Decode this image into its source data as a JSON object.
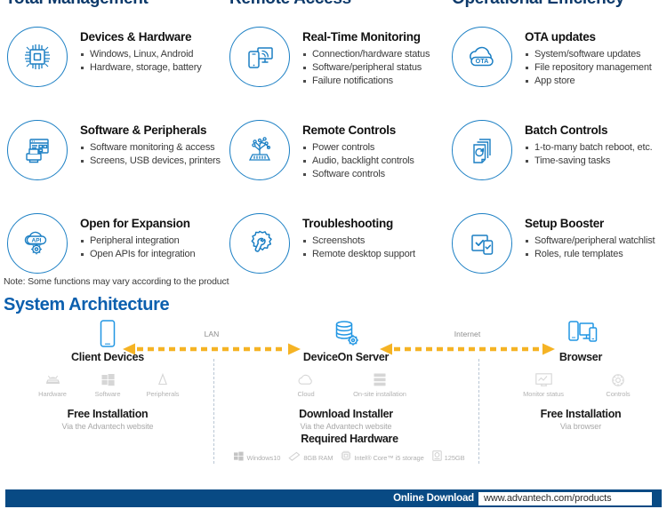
{
  "columns": [
    {
      "heading": "Total Management"
    },
    {
      "heading": "Remote Access"
    },
    {
      "heading": "Operational Efficiency"
    }
  ],
  "features": [
    {
      "icon": "cpu-chip-icon",
      "title": "Devices & Hardware",
      "bullets": [
        "Windows, Linux, Android",
        "Hardware, storage, battery"
      ]
    },
    {
      "icon": "realtime-monitor-icon",
      "title": "Real-Time Monitoring",
      "bullets": [
        "Connection/hardware status",
        "Software/peripheral status",
        "Failure notifications"
      ]
    },
    {
      "icon": "ota-cloud-icon",
      "title": "OTA updates",
      "bullets": [
        "System/software updates",
        "File repository management",
        "App store"
      ]
    },
    {
      "icon": "software-peripherals-icon",
      "title": "Software & Peripherals",
      "bullets": [
        "Software monitoring & access",
        "Screens, USB devices, printers"
      ]
    },
    {
      "icon": "remote-controls-icon",
      "title": "Remote Controls",
      "bullets": [
        "Power controls",
        "Audio, backlight controls",
        "Software controls"
      ]
    },
    {
      "icon": "batch-controls-icon",
      "title": "Batch Controls",
      "bullets": [
        "1-to-many batch reboot, etc.",
        "Time-saving tasks"
      ]
    },
    {
      "icon": "api-expansion-icon",
      "title": "Open for Expansion",
      "bullets": [
        "Peripheral integration",
        "Open APIs for integration"
      ]
    },
    {
      "icon": "troubleshooting-icon",
      "title": "Troubleshooting",
      "bullets": [
        "Screenshots",
        "Remote desktop support"
      ]
    },
    {
      "icon": "setup-booster-icon",
      "title": "Setup Booster",
      "bullets": [
        "Software/peripheral watchlist",
        "Roles, rule templates"
      ]
    }
  ],
  "note": "Note: Some functions may vary according to the product",
  "architecture": {
    "title": "System Architecture",
    "connections": [
      {
        "label": "LAN"
      },
      {
        "label": "Internet"
      }
    ],
    "nodes": [
      {
        "icon": "tablet-device-icon",
        "name": "Client Devices",
        "sub": [
          {
            "icon": "android-icon",
            "label": "Hardware"
          },
          {
            "icon": "windows-icon",
            "label": "Software"
          },
          {
            "icon": "peripherals-drop-icon",
            "label": "Peripherals"
          }
        ],
        "block_title": "Free Installation",
        "block_sub": "Via the Advantech website"
      },
      {
        "icon": "database-gear-icon",
        "name": "DeviceOn Server",
        "sub": [
          {
            "icon": "cloud-icon",
            "label": "Cloud"
          },
          {
            "icon": "onsite-server-icon",
            "label": "On-site installation"
          }
        ],
        "block_title": "Download Installer",
        "block_sub": "Via the Advantech website"
      },
      {
        "icon": "browser-devices-icon",
        "name": "Browser",
        "sub": [
          {
            "icon": "monitor-status-icon",
            "label": "Monitor status"
          },
          {
            "icon": "controls-gear-icon",
            "label": "Controls"
          }
        ],
        "block_title": "Free Installation",
        "block_sub": "Via browser"
      }
    ],
    "required_hardware": {
      "title": "Required Hardware",
      "items": [
        {
          "icon": "windows-logo-icon",
          "label": "Windows10"
        },
        {
          "icon": "ram-stick-icon",
          "label": "8GB RAM"
        },
        {
          "icon": "cpu-icon",
          "label": "Intel® Core™ i5 storage"
        },
        {
          "icon": "harddisk-icon",
          "label": "125GB"
        }
      ]
    }
  },
  "footer": {
    "label": "Online Download",
    "url": "www.advantech.com/products"
  },
  "colors": {
    "brand_blue": "#0b5fae",
    "heading_navy": "#0d3a6b",
    "icon_blue": "#1b7fc4",
    "arrow_amber": "#f5b324",
    "footer_bar": "#084a84"
  }
}
